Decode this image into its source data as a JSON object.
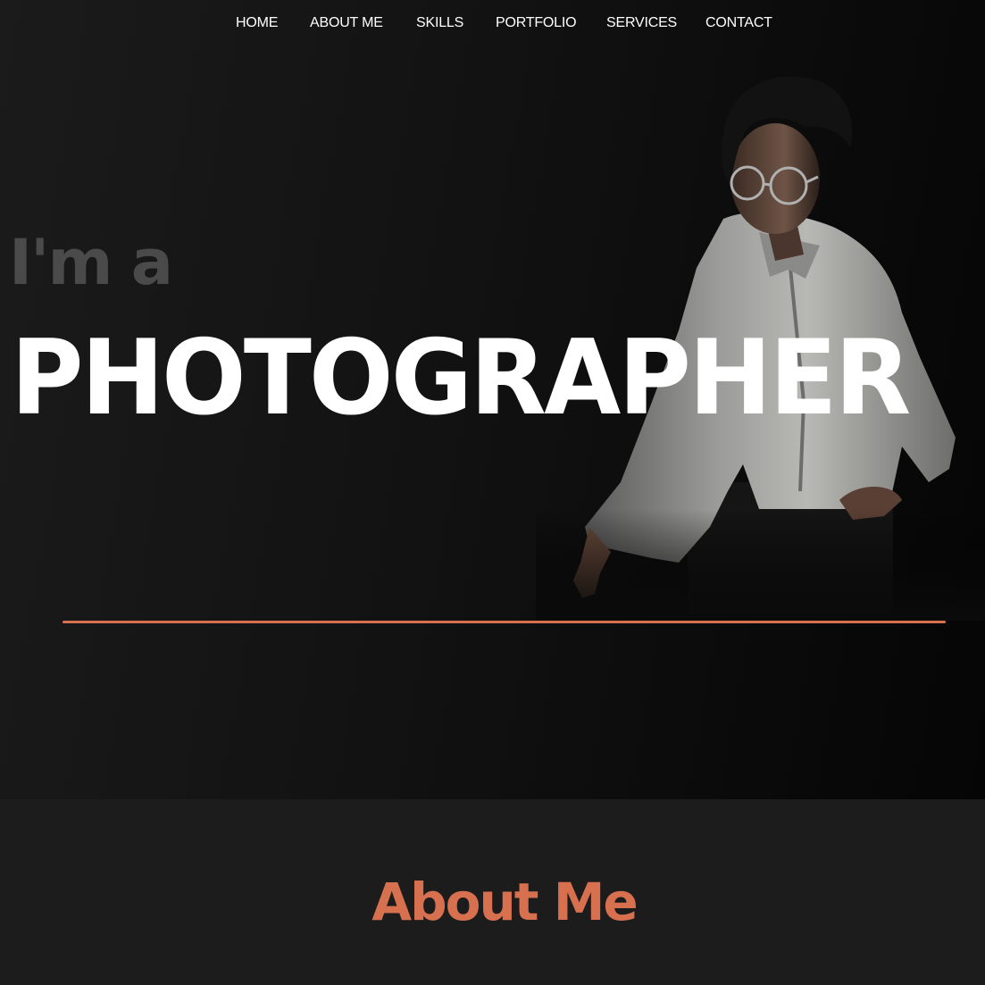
{
  "nav": {
    "items": [
      {
        "label": "HOME"
      },
      {
        "label": "ABOUT ME"
      },
      {
        "label": "SKILLS"
      },
      {
        "label": "PORTFOLIO"
      },
      {
        "label": "SERVICES"
      },
      {
        "label": "CONTACT"
      }
    ]
  },
  "hero": {
    "intro": "I'm a",
    "headline": "PHOTOGRAPHER",
    "photo_icon": "portrait-photo",
    "accent_color": "#d7704f"
  },
  "about": {
    "title": "About Me"
  }
}
